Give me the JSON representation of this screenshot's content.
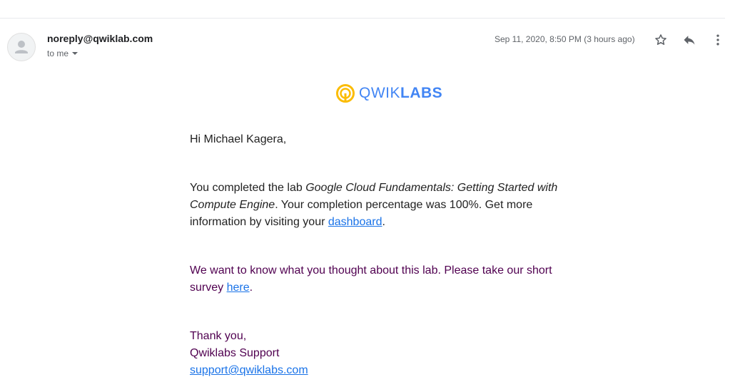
{
  "header": {
    "sender_email": "noreply@qwiklab.com",
    "recipient_label": "to me",
    "timestamp": "Sep 11, 2020, 8:50 PM (3 hours ago)",
    "actions": {
      "star_icon": "star-outline-icon",
      "reply_icon": "reply-icon",
      "more_icon": "more-vertical-icon"
    }
  },
  "logo": {
    "text_light": "QWIK",
    "text_bold": "LABS",
    "brand_color": "#4285f4",
    "mark_color": "#fbbc04"
  },
  "message": {
    "greeting": "Hi Michael Kagera,",
    "completion": {
      "prefix": "You completed the lab ",
      "lab_name_part1": "Google Cloud Fundamentals: Getting Started with",
      "lab_name_part2": "Compute Engine",
      "mid": ". Your completion percentage was 100%. Get more",
      "line3_prefix": "information by visiting your ",
      "dashboard_link": "dashboard",
      "line3_suffix": "."
    },
    "survey": {
      "line1": "We want to know what you thought about this lab. Please take our short",
      "line2_prefix": "survey ",
      "here_link": "here",
      "line2_suffix": "."
    },
    "signoff": {
      "thanks": "Thank you,",
      "team": "Qwiklabs Support",
      "email_link": "support@qwiklabs.com"
    }
  },
  "colors": {
    "body_text": "#222222",
    "quoted_text": "#500050",
    "link": "#1a73e8",
    "meta_text": "#5f6368"
  }
}
